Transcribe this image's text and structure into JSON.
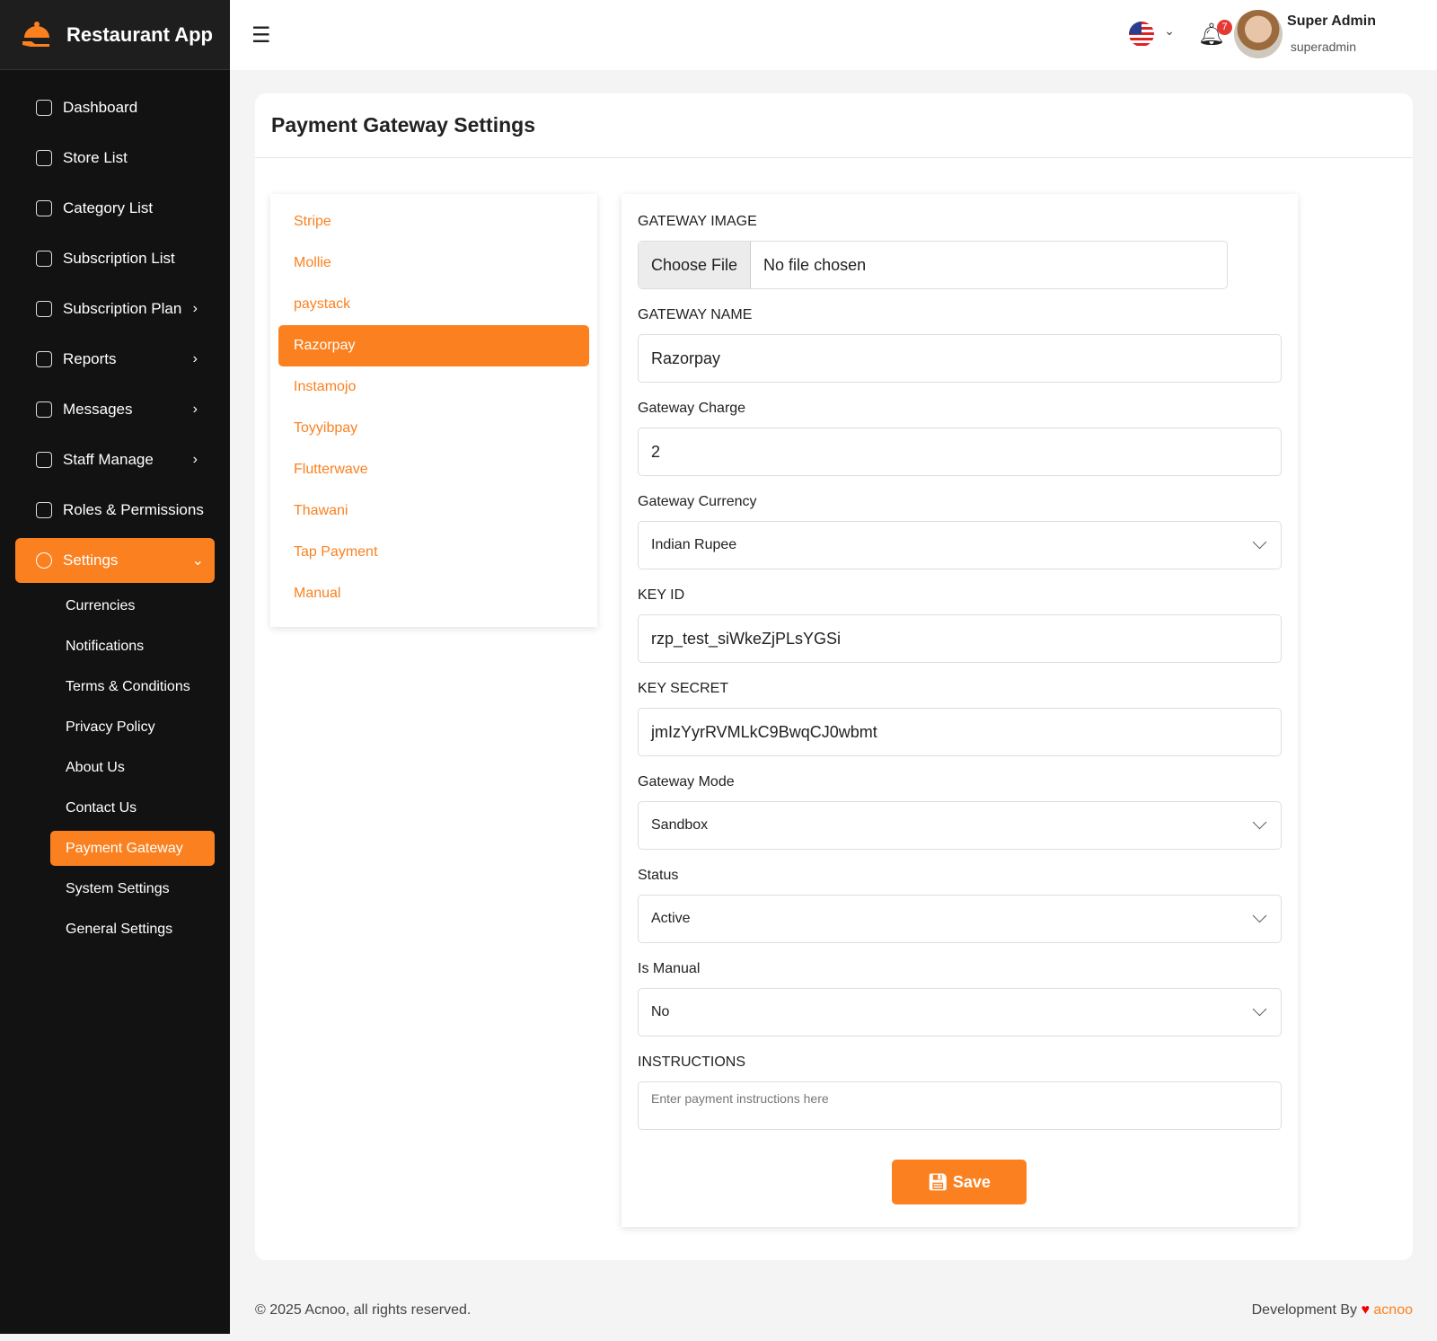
{
  "app": {
    "name": "Restaurant App"
  },
  "sidebar": {
    "items": [
      {
        "label": "Dashboard"
      },
      {
        "label": "Store List"
      },
      {
        "label": "Category List"
      },
      {
        "label": "Subscription List"
      },
      {
        "label": "Subscription Plan"
      },
      {
        "label": "Reports"
      },
      {
        "label": "Messages"
      },
      {
        "label": "Staff Manage"
      },
      {
        "label": "Roles & Permissions"
      },
      {
        "label": "Settings"
      }
    ],
    "settings_sub": [
      {
        "label": "Currencies"
      },
      {
        "label": "Notifications"
      },
      {
        "label": "Terms & Conditions"
      },
      {
        "label": "Privacy Policy"
      },
      {
        "label": "About Us"
      },
      {
        "label": "Contact Us"
      },
      {
        "label": "Payment Gateway"
      },
      {
        "label": "System Settings"
      },
      {
        "label": "General Settings"
      }
    ]
  },
  "header": {
    "notification_count": "7",
    "user_name": "Super Admin",
    "user_role": "superadmin"
  },
  "page": {
    "title": "Payment Gateway Settings"
  },
  "gateways": [
    "Stripe",
    "Mollie",
    "paystack",
    "Razorpay",
    "Instamojo",
    "Toyyibpay",
    "Flutterwave",
    "Thawani",
    "Tap Payment",
    "Manual"
  ],
  "form": {
    "image_label": "GATEWAY IMAGE",
    "choose_file": "Choose File",
    "no_file": "No file chosen",
    "name_label": "GATEWAY NAME",
    "name_value": "Razorpay",
    "charge_label": "Gateway Charge",
    "charge_value": "2",
    "currency_label": "Gateway Currency",
    "currency_value": "Indian Rupee",
    "keyid_label": "KEY ID",
    "keyid_value": "rzp_test_siWkeZjPLsYGSi",
    "secret_label": "KEY SECRET",
    "secret_value": "jmIzYyrRVMLkC9BwqCJ0wbmt",
    "mode_label": "Gateway Mode",
    "mode_value": "Sandbox",
    "status_label": "Status",
    "status_value": "Active",
    "manual_label": "Is Manual",
    "manual_value": "No",
    "instructions_label": "INSTRUCTIONS",
    "instructions_placeholder": "Enter payment instructions here",
    "save_label": "Save"
  },
  "footer": {
    "copyright": "© 2025 Acnoo, all rights reserved.",
    "dev_by": "Development By",
    "dev_link": "acnoo"
  }
}
